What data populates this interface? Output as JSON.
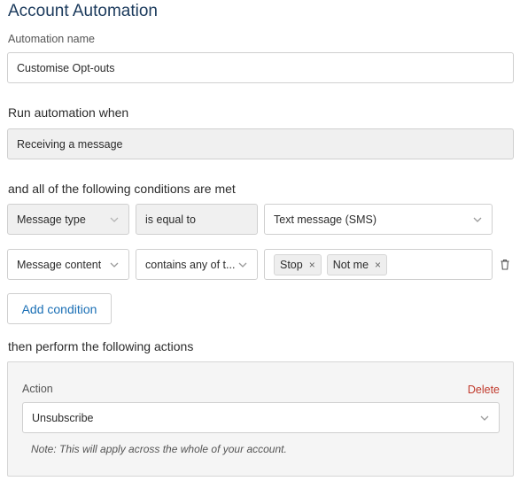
{
  "page": {
    "title": "Account Automation"
  },
  "automation_name": {
    "label": "Automation name",
    "value": "Customise Opt-outs"
  },
  "trigger": {
    "label": "Run automation when",
    "value": "Receiving a message"
  },
  "conditions": {
    "label": "and all of the following conditions are met",
    "rows": [
      {
        "field": "Message type",
        "operator": "is equal to",
        "value": "Text message (SMS)"
      },
      {
        "field": "Message content",
        "operator": "contains any of t...",
        "tags": [
          "Stop",
          "Not me"
        ]
      }
    ],
    "add_label": "Add condition",
    "tag_remove_glyph": "×"
  },
  "actions": {
    "label": "then perform the following actions",
    "action_label": "Action",
    "delete_label": "Delete",
    "action_value": "Unsubscribe",
    "note": "Note: This will apply across the whole of your account."
  },
  "icons": {
    "dropdown": "chevron-down-icon",
    "delete_condition": "trash-icon"
  },
  "colors": {
    "title": "#1b3a5c",
    "link": "#1a6fb5",
    "delete": "#c0392b",
    "readonly_bg": "#f0f0f0"
  }
}
